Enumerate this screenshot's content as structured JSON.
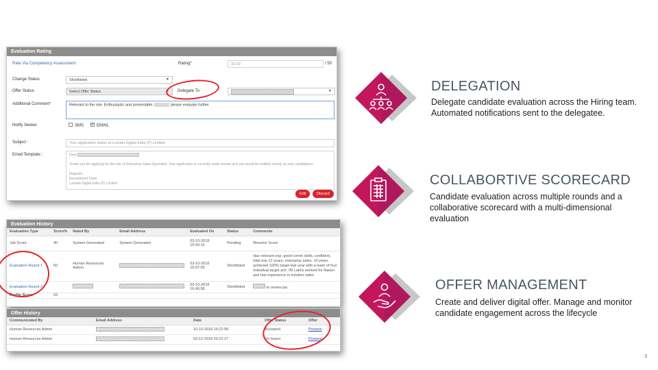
{
  "rating_panel": {
    "title": "Evaluation Rating",
    "rate_via": "Rate Via Competency Assessment",
    "rating_label": "Rating*",
    "rating_value": "32.00",
    "rating_max": "/ 50",
    "change_status_label": "Change Status",
    "change_status_value": "Shortlisted",
    "offer_status_label": "Offer Status",
    "offer_status_value": "Select Offer Status",
    "delegate_to_label": "Delegate To",
    "additional_comment_label": "Additional Comment*",
    "additional_comment_value": "Relevant to the role. Enthusiastic and presentable.",
    "additional_comment_tail": "please evaluate further",
    "notify_label": "Notify Seeker",
    "sms_label": "SMS",
    "email_label": "EMAIL",
    "subject_label": "Subject :",
    "subject_placeholder": "Your application status at Lumata Digital India (P) Limited",
    "template_label": "Email Template :",
    "template_dear": "Dear",
    "template_body": "Thank you for applying for the role of Enterprise Sales Specialist. Your application is currently under review and you would be notified shortly on your candidature.",
    "template_regards": "Regards,",
    "template_team": "Recruitment Team",
    "template_company": "Lumata Digital India (P) Limited",
    "edit_label": "Edit",
    "discard_label": "Discard"
  },
  "history_panel": {
    "title": "Evaluation History",
    "columns": [
      "Evaluation Type",
      "Score%",
      "Rated By",
      "Email Address",
      "Evaluated On",
      "Status",
      "Comments"
    ],
    "rows": [
      {
        "type": "Job Score",
        "score": "40",
        "rated_by": "System Generated",
        "email": "System Generated",
        "date": "03-10-2018",
        "time": "15:43:15",
        "status": "Pending",
        "comment": "Resume Score"
      },
      {
        "type": "Evaluation Round 1",
        "score": "60",
        "rated_by": "Human Resources Admin",
        "email": "",
        "date": "03-10-2018",
        "time": "16:07:09",
        "status": "Shortlisted",
        "comment": "Has relevant exp, good comm skills, confident, total exp 12 years, enterprise sales: 10 years achieved 100% target last year with a team of four individual target ach: 99 Lakhs worked for Naukri and has experience in solution sales"
      },
      {
        "type": "Evaluation Round 2",
        "score": "",
        "rated_by": "",
        "email": "",
        "date": "03-10-2018",
        "time": "16:40:58",
        "status": "Shortlisted",
        "comment": "to review pls."
      }
    ],
    "profile_score_label": "Profile Score",
    "profile_score_value": "53"
  },
  "offer_panel": {
    "title": "Offer History",
    "columns": [
      "Communicated By",
      "Email Address",
      "Date",
      "Offer Status",
      "Offer"
    ],
    "rows": [
      {
        "by": "Human Resources Admin",
        "date": "10-10-2018 16:22:58",
        "status": "Accepted",
        "offer": "Preview"
      },
      {
        "by": "Human Resources Admin",
        "date": "03-12-2018 20:22:27",
        "status": "On board",
        "offer": "Preview"
      }
    ]
  },
  "features": [
    {
      "title": "DELEGATION",
      "desc": "Delegate candidate evaluation across the Hiring team. Automated notifications sent to the delegatee.",
      "icon": "team-hierarchy-icon"
    },
    {
      "title": "COLLABORTIVE SCORECARD",
      "desc": "Candidate evaluation across multiple rounds and a collaborative scorecard with a multi-dimensional evaluation",
      "icon": "clipboard-scorecard-icon"
    },
    {
      "title": "OFFER MANAGEMENT",
      "desc": "Create and deliver digital offer. Manage and monitor candidate engagement across the lifecycle",
      "icon": "hand-person-icon"
    }
  ],
  "colors": {
    "accent_red": "#e8202a",
    "magenta": "#c2185b",
    "header_grey": "#8c8c8c"
  },
  "page_number": "3"
}
